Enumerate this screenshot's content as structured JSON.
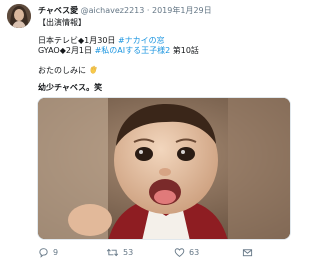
{
  "tweet": {
    "display_name": "チャベス愛",
    "handle": "@aichavez2213",
    "separator": "·",
    "date": "2019年1月29日",
    "lines": {
      "l1": "【出演情報】",
      "l2_prefix": "日本テレビ◆1月30日",
      "l2_tag": "#ナカイの窓",
      "l3_prefix": "GYAO◆2月1日",
      "l3_tag": "#私のAIする王子様2",
      "l3_suffix": "第10話",
      "l4": "おたのしみに",
      "l5": "幼少チャベス。笑"
    },
    "actions": {
      "reply_count": "9",
      "retweet_count": "53",
      "like_count": "63"
    }
  },
  "colors": {
    "link": "#1b95e0",
    "meta": "#657786",
    "text": "#14171a",
    "like_red": "#e0245e"
  },
  "icons": {
    "reply": "speech-bubble",
    "retweet": "retweet-arrows",
    "like": "heart",
    "emoji": "waving-hand"
  }
}
